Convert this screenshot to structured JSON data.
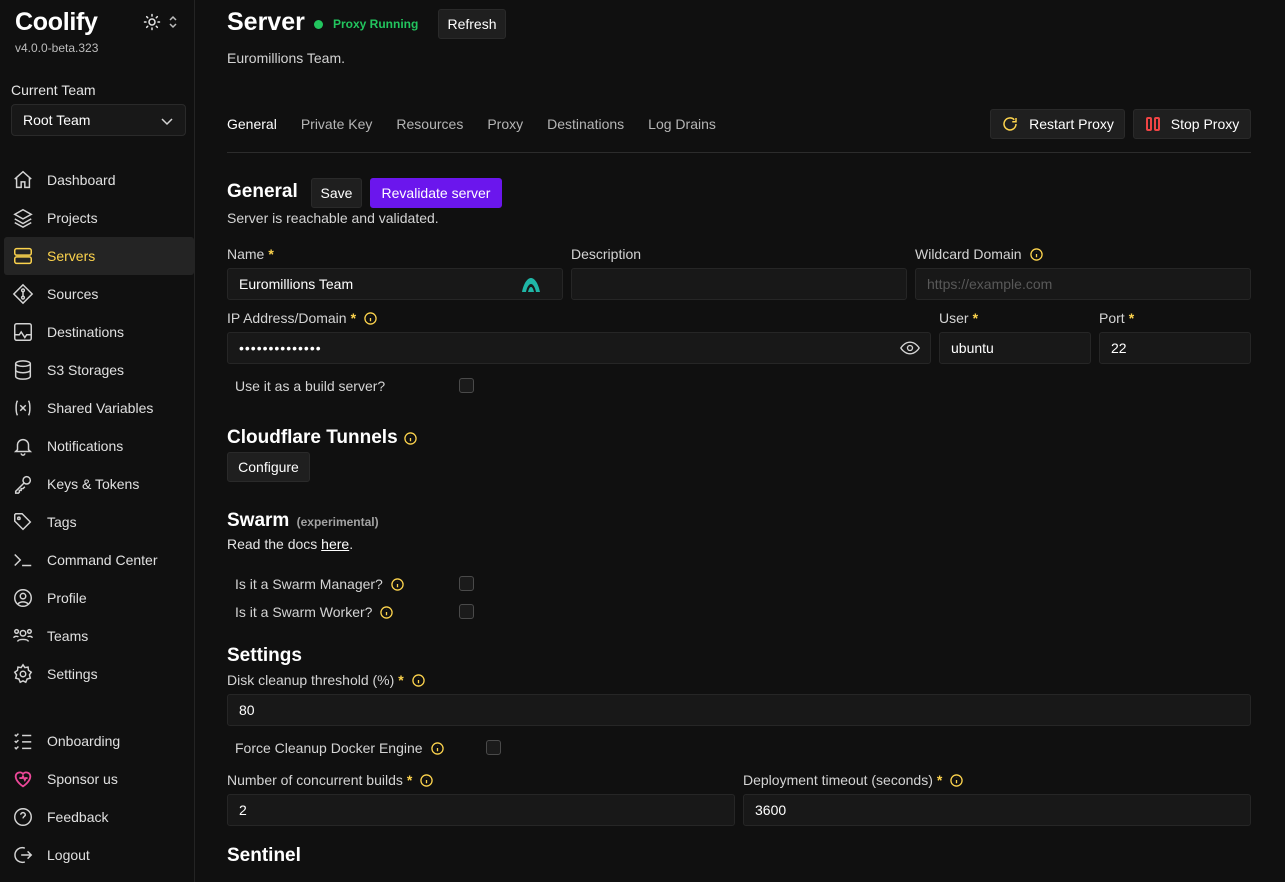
{
  "app": {
    "name": "Coolify",
    "version": "v4.0.0-beta.323"
  },
  "team": {
    "label": "Current Team",
    "selected": "Root Team"
  },
  "sidebar": {
    "items": [
      {
        "label": "Dashboard",
        "icon": "home-icon"
      },
      {
        "label": "Projects",
        "icon": "layers-icon"
      },
      {
        "label": "Servers",
        "icon": "server-icon",
        "active": true
      },
      {
        "label": "Sources",
        "icon": "git-icon"
      },
      {
        "label": "Destinations",
        "icon": "docker-icon"
      },
      {
        "label": "S3 Storages",
        "icon": "database-icon"
      },
      {
        "label": "Shared Variables",
        "icon": "variable-icon"
      },
      {
        "label": "Notifications",
        "icon": "bell-icon"
      },
      {
        "label": "Keys & Tokens",
        "icon": "key-icon"
      },
      {
        "label": "Tags",
        "icon": "tag-icon"
      },
      {
        "label": "Command Center",
        "icon": "terminal-icon"
      },
      {
        "label": "Profile",
        "icon": "user-icon"
      },
      {
        "label": "Teams",
        "icon": "users-icon"
      },
      {
        "label": "Settings",
        "icon": "gear-icon"
      }
    ],
    "bottom": [
      {
        "label": "Onboarding",
        "icon": "checklist-icon"
      },
      {
        "label": "Sponsor us",
        "icon": "heart-icon"
      },
      {
        "label": "Feedback",
        "icon": "help-icon"
      },
      {
        "label": "Logout",
        "icon": "logout-icon"
      }
    ]
  },
  "header": {
    "title": "Server",
    "status": "Proxy Running",
    "refresh": "Refresh",
    "subtitle": "Euromillions Team."
  },
  "tabs": [
    "General",
    "Private Key",
    "Resources",
    "Proxy",
    "Destinations",
    "Log Drains"
  ],
  "actions": {
    "restart": "Restart Proxy",
    "stop": "Stop Proxy"
  },
  "general": {
    "title": "General",
    "save": "Save",
    "revalidate": "Revalidate server",
    "status_text": "Server is reachable and validated.",
    "name_label": "Name",
    "name_value": "Euromillions Team",
    "description_label": "Description",
    "description_value": "",
    "wildcard_label": "Wildcard Domain",
    "wildcard_placeholder": "https://example.com",
    "ip_label": "IP Address/Domain",
    "ip_value": "••••••••••••••",
    "user_label": "User",
    "user_value": "ubuntu",
    "port_label": "Port",
    "port_value": "22",
    "build_server_label": "Use it as a build server?",
    "required_mark": "*"
  },
  "cloudflare": {
    "title": "Cloudflare Tunnels",
    "configure": "Configure"
  },
  "swarm": {
    "title": "Swarm",
    "tag": "(experimental)",
    "docs_prefix": "Read the docs ",
    "docs_link": "here",
    "docs_suffix": ".",
    "manager_label": "Is it a Swarm Manager?",
    "worker_label": "Is it a Swarm Worker?"
  },
  "settings": {
    "title": "Settings",
    "disk_label": "Disk cleanup threshold (%)",
    "disk_value": "80",
    "force_cleanup_label": "Force Cleanup Docker Engine",
    "builds_label": "Number of concurrent builds",
    "builds_value": "2",
    "timeout_label": "Deployment timeout (seconds)",
    "timeout_value": "3600"
  },
  "sentinel": {
    "title": "Sentinel"
  }
}
